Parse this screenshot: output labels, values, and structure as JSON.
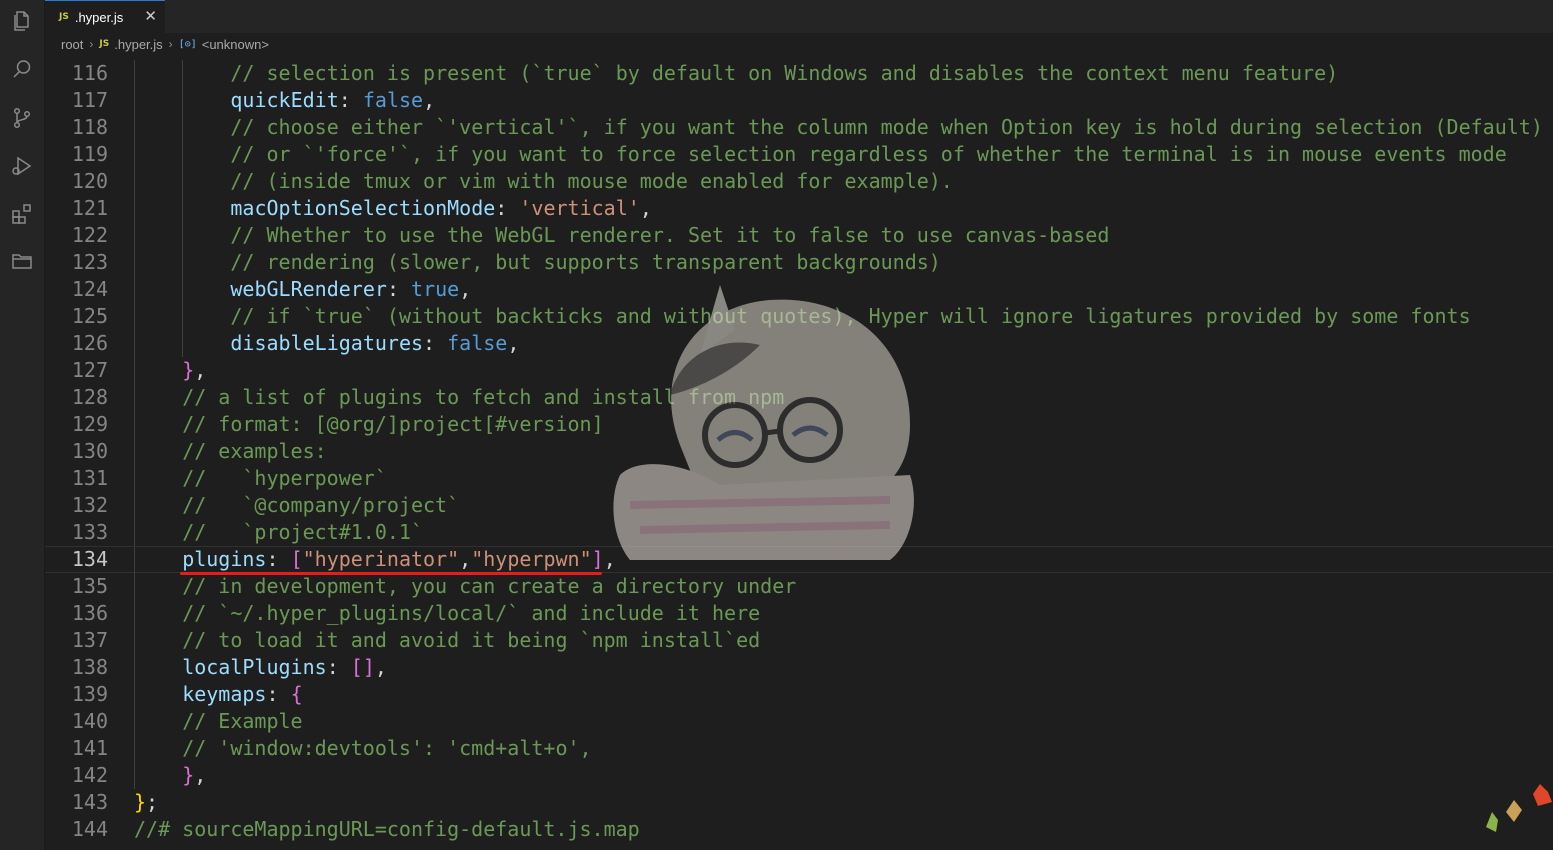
{
  "tab": {
    "badge": "JS",
    "filename": ".hyper.js",
    "close_glyph": "✕"
  },
  "breadcrumb": {
    "root": "root",
    "file_badge": "JS",
    "file": ".hyper.js",
    "symbol_badge": "[⊙]",
    "symbol": "<unknown>"
  },
  "activity_bar": {
    "icons": [
      "explorer-icon",
      "search-icon",
      "source-control-icon",
      "run-debug-icon",
      "extensions-icon",
      "folder-icon"
    ]
  },
  "colors": {
    "editor_bg": "#1e1e1e",
    "comment": "#6a9955",
    "property": "#9cdcfe",
    "keyword": "#569cd6",
    "string": "#ce9178",
    "bracket_pink": "#da70d6",
    "bracket_gold": "#ffd700",
    "underline": "#e81c1c"
  },
  "editor": {
    "current_line": 134,
    "lines": [
      {
        "n": "116",
        "indent": 2,
        "t": [
          [
            "com",
            "// selection is present (`true` by default on Windows and disables the context menu feature)"
          ]
        ]
      },
      {
        "n": "117",
        "indent": 2,
        "t": [
          [
            "prop",
            "quickEdit"
          ],
          [
            "punc",
            ": "
          ],
          [
            "bool",
            "false"
          ],
          [
            "punc",
            ","
          ]
        ]
      },
      {
        "n": "118",
        "indent": 2,
        "t": [
          [
            "com",
            "// choose either `'vertical'`, if you want the column mode when Option key is hold during selection (Default)"
          ]
        ]
      },
      {
        "n": "119",
        "indent": 2,
        "t": [
          [
            "com",
            "// or `'force'`, if you want to force selection regardless of whether the terminal is in mouse events mode"
          ]
        ]
      },
      {
        "n": "120",
        "indent": 2,
        "t": [
          [
            "com",
            "// (inside tmux or vim with mouse mode enabled for example)."
          ]
        ]
      },
      {
        "n": "121",
        "indent": 2,
        "t": [
          [
            "prop",
            "macOptionSelectionMode"
          ],
          [
            "punc",
            ": "
          ],
          [
            "str",
            "'vertical'"
          ],
          [
            "punc",
            ","
          ]
        ]
      },
      {
        "n": "122",
        "indent": 2,
        "t": [
          [
            "com",
            "// Whether to use the WebGL renderer. Set it to false to use canvas-based"
          ]
        ]
      },
      {
        "n": "123",
        "indent": 2,
        "t": [
          [
            "com",
            "// rendering (slower, but supports transparent backgrounds)"
          ]
        ]
      },
      {
        "n": "124",
        "indent": 2,
        "t": [
          [
            "prop",
            "webGLRenderer"
          ],
          [
            "punc",
            ": "
          ],
          [
            "bool",
            "true"
          ],
          [
            "punc",
            ","
          ]
        ]
      },
      {
        "n": "125",
        "indent": 2,
        "t": [
          [
            "com",
            "// if `true` (without backticks and without quotes), Hyper will ignore ligatures provided by some fonts"
          ]
        ]
      },
      {
        "n": "126",
        "indent": 2,
        "t": [
          [
            "prop",
            "disableLigatures"
          ],
          [
            "punc",
            ": "
          ],
          [
            "bool",
            "false"
          ],
          [
            "punc",
            ","
          ]
        ]
      },
      {
        "n": "127",
        "indent": 1,
        "t": [
          [
            "br1",
            "}"
          ],
          [
            "punc",
            ","
          ]
        ]
      },
      {
        "n": "128",
        "indent": 1,
        "t": [
          [
            "com",
            "// a list of plugins to fetch and install from npm"
          ]
        ]
      },
      {
        "n": "129",
        "indent": 1,
        "t": [
          [
            "com",
            "// format: [@org/]project[#version]"
          ]
        ]
      },
      {
        "n": "130",
        "indent": 1,
        "t": [
          [
            "com",
            "// examples:"
          ]
        ]
      },
      {
        "n": "131",
        "indent": 1,
        "t": [
          [
            "com",
            "//   `hyperpower`"
          ]
        ]
      },
      {
        "n": "132",
        "indent": 1,
        "t": [
          [
            "com",
            "//   `@company/project`"
          ]
        ]
      },
      {
        "n": "133",
        "indent": 1,
        "t": [
          [
            "com",
            "//   `project#1.0.1`"
          ]
        ]
      },
      {
        "n": "134",
        "indent": 1,
        "t": [
          [
            "prop",
            "plugins"
          ],
          [
            "punc",
            ": "
          ],
          [
            "br1",
            "["
          ],
          [
            "str",
            "\"hyperinator\""
          ],
          [
            "punc",
            ","
          ],
          [
            "str",
            "\"hyperpwn\""
          ],
          [
            "br1",
            "]"
          ],
          [
            "punc",
            ","
          ]
        ]
      },
      {
        "n": "135",
        "indent": 1,
        "t": [
          [
            "com",
            "// in development, you can create a directory under"
          ]
        ]
      },
      {
        "n": "136",
        "indent": 1,
        "t": [
          [
            "com",
            "// `~/.hyper_plugins/local/` and include it here"
          ]
        ]
      },
      {
        "n": "137",
        "indent": 1,
        "t": [
          [
            "com",
            "// to load it and avoid it being `npm install`ed"
          ]
        ]
      },
      {
        "n": "138",
        "indent": 1,
        "t": [
          [
            "prop",
            "localPlugins"
          ],
          [
            "punc",
            ": "
          ],
          [
            "br1",
            "[]"
          ],
          [
            "punc",
            ","
          ]
        ]
      },
      {
        "n": "139",
        "indent": 1,
        "t": [
          [
            "prop",
            "keymaps"
          ],
          [
            "punc",
            ": "
          ],
          [
            "br1",
            "{"
          ]
        ]
      },
      {
        "n": "140",
        "indent": 1,
        "t": [
          [
            "com",
            "// Example"
          ]
        ]
      },
      {
        "n": "141",
        "indent": 1,
        "t": [
          [
            "com",
            "// 'window:devtools': 'cmd+alt+o',"
          ]
        ]
      },
      {
        "n": "142",
        "indent": 1,
        "t": [
          [
            "br1",
            "}"
          ],
          [
            "punc",
            ","
          ]
        ]
      },
      {
        "n": "143",
        "indent": 0,
        "t": [
          [
            "br2",
            "}"
          ],
          [
            "punc",
            ";"
          ]
        ]
      },
      {
        "n": "144",
        "indent": 0,
        "t": [
          [
            "com",
            "//# sourceMappingURL=config-default.js.map"
          ]
        ]
      }
    ]
  }
}
